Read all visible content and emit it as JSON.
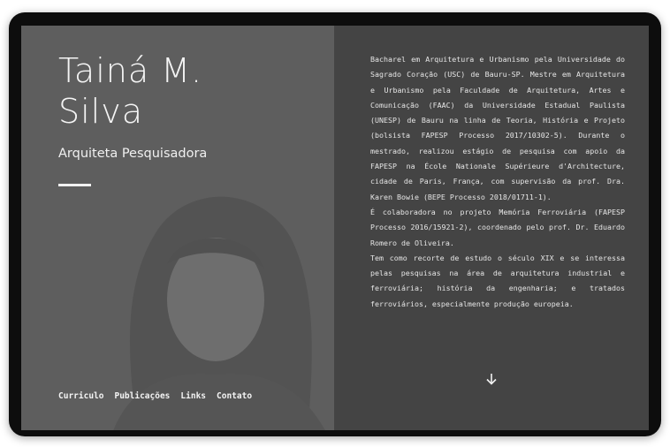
{
  "profile": {
    "name_line1": "Tainá M.",
    "name_line2": "Silva",
    "role": "Arquiteta Pesquisadora"
  },
  "nav": {
    "items": [
      {
        "label": "Curriculo"
      },
      {
        "label": "Publicações"
      },
      {
        "label": "Links"
      },
      {
        "label": "Contato"
      }
    ]
  },
  "bio": {
    "paragraphs": [
      "Bacharel em Arquitetura e Urbanismo pela Universidade do Sagrado Coração (USC) de Bauru-SP. Mestre em Arquitetura e Urbanismo pela Faculdade de Arquitetura, Artes e Comunicação (FAAC) da Universidade Estadual Paulista (UNESP) de Bauru na linha de Teoria, História e Projeto (bolsista FAPESP Processo 2017/10302-5). Durante o mestrado, realizou estágio de pesquisa com apoio da FAPESP na École Nationale Supérieure d'Architecture, cidade de Paris, França, com supervisão da prof. Dra. Karen Bowie (BEPE Processo 2018/01711-1).",
      "É colaboradora no projeto Memória Ferroviária (FAPESP Processo 2016/15921-2), coordenado pelo prof. Dr. Eduardo Romero de Oliveira.",
      "Tem como recorte de estudo o século XIX e se interessa pelas pesquisas na área de arquitetura industrial e ferroviária; história da engenharia; e tratados ferroviários, especialmente produção europeia."
    ]
  },
  "colors": {
    "left_panel": "#5e5e5e",
    "right_panel": "#444444",
    "frame": "#0d0d0d",
    "text": "#f4f4f4"
  },
  "icons": {
    "scroll": "arrow-down-icon"
  }
}
